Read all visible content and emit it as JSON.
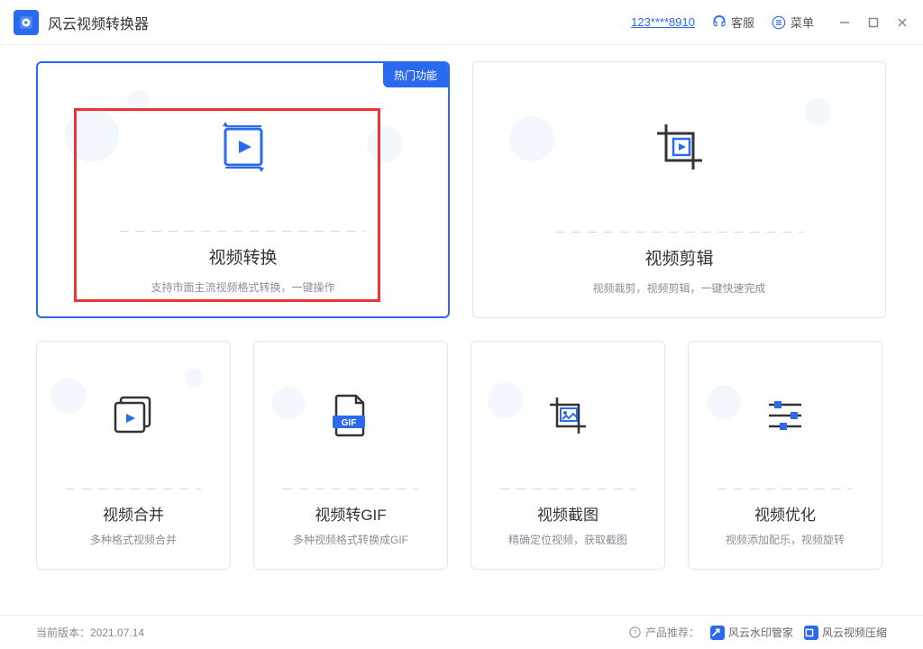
{
  "header": {
    "app_title": "风云视频转换器",
    "user_id": "123****8910",
    "support": "客服",
    "menu": "菜单"
  },
  "cards_big": [
    {
      "title": "视频转换",
      "desc": "支持市面主流视频格式转换，一键操作",
      "badge": "热门功能"
    },
    {
      "title": "视频剪辑",
      "desc": "视频裁剪，视频剪辑，一键快速完成"
    }
  ],
  "cards_small": [
    {
      "title": "视频合并",
      "desc": "多种格式视频合并"
    },
    {
      "title": "视频转GIF",
      "desc": "多种视频格式转换成GIF"
    },
    {
      "title": "视频截图",
      "desc": "精确定位视频，获取截图"
    },
    {
      "title": "视频优化",
      "desc": "视频添加配乐，视频旋转"
    }
  ],
  "footer": {
    "version_label": "当前版本：",
    "version": "2021.07.14",
    "recommend_label": "产品推荐：",
    "rec1": "风云水印管家",
    "rec2": "风云视频压缩"
  }
}
